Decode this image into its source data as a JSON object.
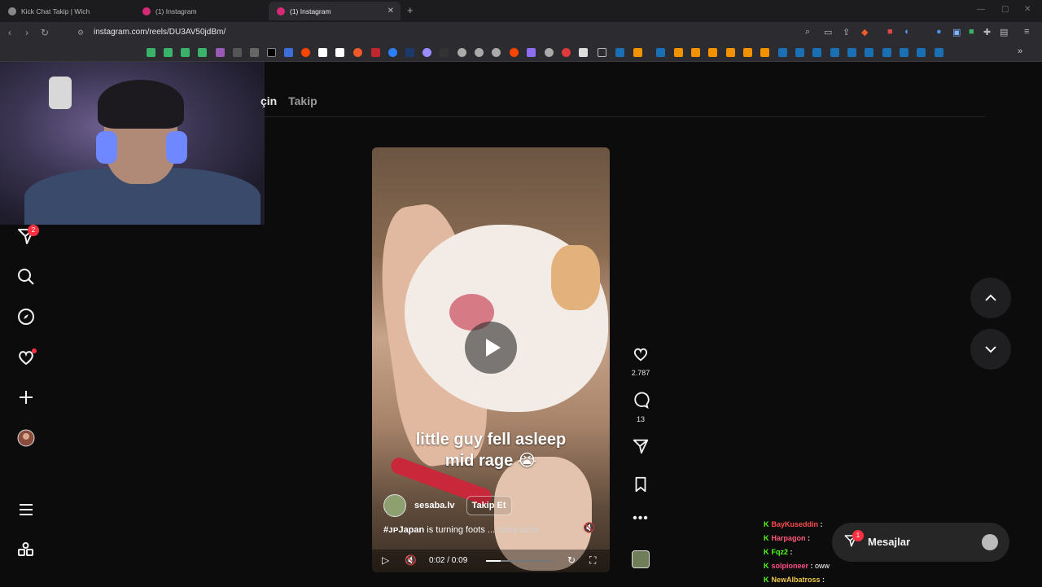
{
  "browser": {
    "tabs": [
      {
        "label": "Kick Chat Takip | Wich"
      },
      {
        "label": "(1) Instagram"
      },
      {
        "label": "(1) Instagram"
      }
    ],
    "url": "instagram.com/reels/DU3AV50jdBm/"
  },
  "instagram": {
    "top_tabs": [
      "çin",
      "Takip"
    ],
    "sidebar_badge": "2",
    "reel": {
      "caption_line1": "little guy fell asleep",
      "caption_line2": "mid rage 😭",
      "author": "sesaba.lv",
      "follow_label": "Takip Et",
      "desc_tag": "#ᴊᴘJapan",
      "desc_text": " is turning foots ... ",
      "desc_more": "daha fazla",
      "time": "0:02 / 0:09",
      "progress": 0.22
    },
    "actions": {
      "likes": "2.787",
      "comments": "13"
    },
    "messages": {
      "label": "Mesajlar",
      "badge": "1"
    }
  },
  "chat": [
    {
      "user": "BayKuseddin",
      "user_color": "#ff4d4d",
      "text": ""
    },
    {
      "user": "Harpagon",
      "user_color": "#ff5a7a",
      "text": ""
    },
    {
      "user": "Fqz2",
      "user_color": "#53fc18",
      "text": ""
    },
    {
      "user": "solpioneer",
      "user_color": "#ff4d8a",
      "text": "oww"
    },
    {
      "user": "NewAlbatross",
      "user_color": "#f2c94c",
      "text": ""
    }
  ]
}
